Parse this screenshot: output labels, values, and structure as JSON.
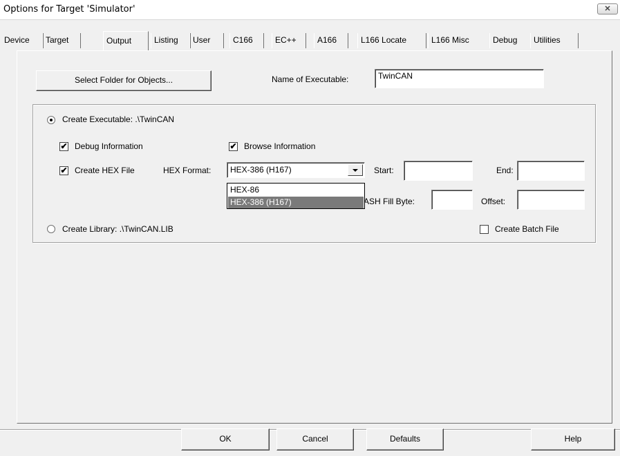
{
  "window": {
    "title": "Options for Target 'Simulator'",
    "close_glyph": "✕"
  },
  "tabs": [
    {
      "label": "Device"
    },
    {
      "label": "Target"
    },
    {
      "label": "Output"
    },
    {
      "label": "Listing"
    },
    {
      "label": "User"
    },
    {
      "label": "C166"
    },
    {
      "label": "EC++"
    },
    {
      "label": "A166"
    },
    {
      "label": "L166 Locate"
    },
    {
      "label": "L166 Misc"
    },
    {
      "label": "Debug"
    },
    {
      "label": "Utilities"
    }
  ],
  "active_tab": "Output",
  "output": {
    "select_folder_label": "Select Folder for Objects...",
    "name_of_executable_label": "Name of Executable:",
    "name_of_executable_value": "TwinCAN",
    "create_executable_label": "Create Executable:  .\\TwinCAN",
    "create_executable_selected": true,
    "debug_info_label": "Debug Information",
    "debug_info_checked": true,
    "browse_info_label": "Browse Information",
    "browse_info_checked": true,
    "create_hex_label": "Create HEX File",
    "create_hex_checked": true,
    "hex_format_label": "HEX Format:",
    "hex_format_value": "HEX-386 (H167)",
    "hex_format_options": [
      "HEX-86",
      "HEX-386 (H167)"
    ],
    "start_label": "Start:",
    "start_value": "",
    "end_label": "End:",
    "end_value": "",
    "flash_fill_label": "ASH Fill Byte:",
    "flash_fill_value": "",
    "offset_label": "Offset:",
    "offset_value": "",
    "create_library_label": "Create Library:  .\\TwinCAN.LIB",
    "create_library_selected": false,
    "create_batch_label": "Create Batch File",
    "create_batch_checked": false,
    "check_glyph": "✔"
  },
  "buttons": {
    "ok": "OK",
    "cancel": "Cancel",
    "defaults": "Defaults",
    "help": "Help"
  }
}
